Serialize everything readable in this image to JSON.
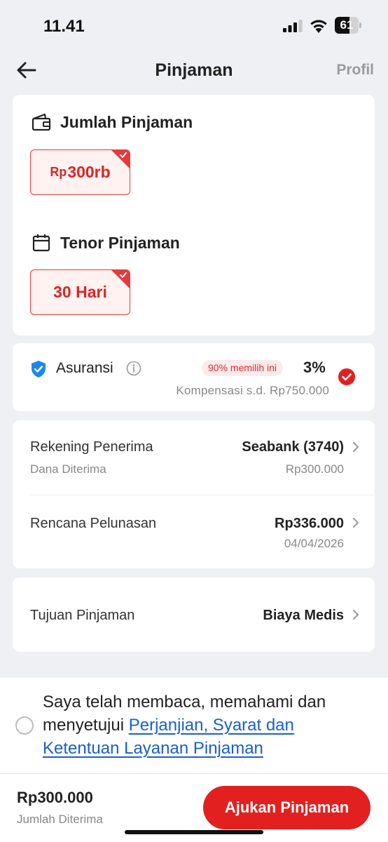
{
  "status_bar": {
    "time": "11.41",
    "battery_level": "61",
    "battery_fraction": 0.61
  },
  "nav": {
    "title": "Pinjaman",
    "profile_link": "Profil",
    "back_icon": "arrow-left-icon"
  },
  "loan_amount": {
    "title": "Jumlah Pinjaman",
    "icon": "wallet-icon",
    "selected_prefix": "Rp",
    "selected_value": "300rb"
  },
  "tenor": {
    "title": "Tenor Pinjaman",
    "icon": "calendar-icon",
    "selected_value": "30 Hari"
  },
  "insurance": {
    "label": "Asuransi",
    "icon": "shield-check-icon",
    "popular_badge": "90% memilih ini",
    "rate": "3%",
    "compensation": "Kompensasi s.d. Rp750.000",
    "selected": true
  },
  "details": {
    "recipient": {
      "label": "Rekening Penerima",
      "value": "Seabank (3740)",
      "sub_label": "Dana Diterima",
      "sub_value": "Rp300.000"
    },
    "repayment": {
      "label": "Rencana Pelunasan",
      "value": "Rp336.000",
      "sub_value": "04/04/2026"
    },
    "purpose": {
      "label": "Tujuan Pinjaman",
      "value": "Biaya Medis"
    }
  },
  "agreement": {
    "text": "Saya telah membaca, memahami dan menyetujui",
    "link": "Perjanjian, Syarat dan Ketentuan Layanan Pinjaman",
    "checked": false
  },
  "footer": {
    "amount": "Rp300.000",
    "amount_label": "Jumlah Diterima",
    "submit_label": "Ajukan Pinjaman"
  },
  "colors": {
    "accent": "#e22020",
    "link": "#1a5fc9",
    "badge_bg": "#fdeaea",
    "shield": "#1e88e5"
  }
}
